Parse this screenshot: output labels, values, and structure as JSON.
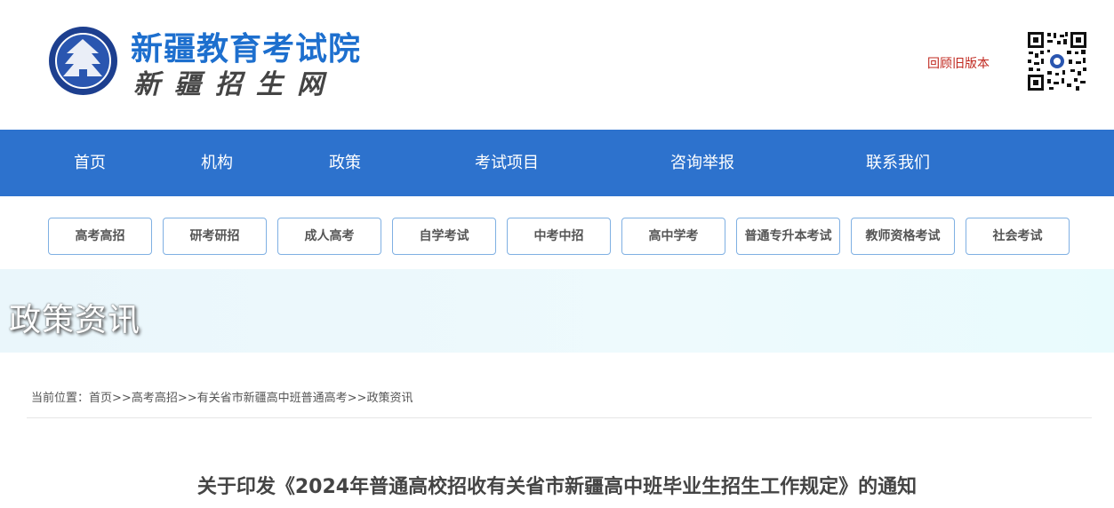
{
  "header": {
    "site_title": "新疆教育考试院",
    "site_subtitle": "新疆招生网",
    "old_version_link": "回顾旧版本",
    "logo_icon": "exam-authority-emblem-icon",
    "qr_icon": "qr-code-icon",
    "colors": {
      "title": "#1d6fce",
      "link": "#c0281f"
    }
  },
  "nav": {
    "background": "#2d72cd",
    "items": [
      {
        "label": "首页"
      },
      {
        "label": "机构"
      },
      {
        "label": "政策"
      },
      {
        "label": "考试项目"
      },
      {
        "label": "咨询举报"
      },
      {
        "label": "联系我们"
      }
    ]
  },
  "categories": [
    {
      "label": "高考高招"
    },
    {
      "label": "研考研招"
    },
    {
      "label": "成人高考"
    },
    {
      "label": "自学考试"
    },
    {
      "label": "中考中招"
    },
    {
      "label": "高中学考"
    },
    {
      "label": "普通专升本考试"
    },
    {
      "label": "教师资格考试"
    },
    {
      "label": "社会考试"
    }
  ],
  "banner": {
    "title": "政策资讯"
  },
  "breadcrumb": {
    "prefix": "当前位置：",
    "items": [
      {
        "label": "首页"
      },
      {
        "label": "高考高招"
      },
      {
        "label": "有关省市新疆高中班普通高考"
      },
      {
        "label": "政策资讯"
      }
    ],
    "separator": ">>"
  },
  "article": {
    "title": "关于印发《2024年普通高校招收有关省市新疆高中班毕业生招生工作规定》的通知"
  }
}
